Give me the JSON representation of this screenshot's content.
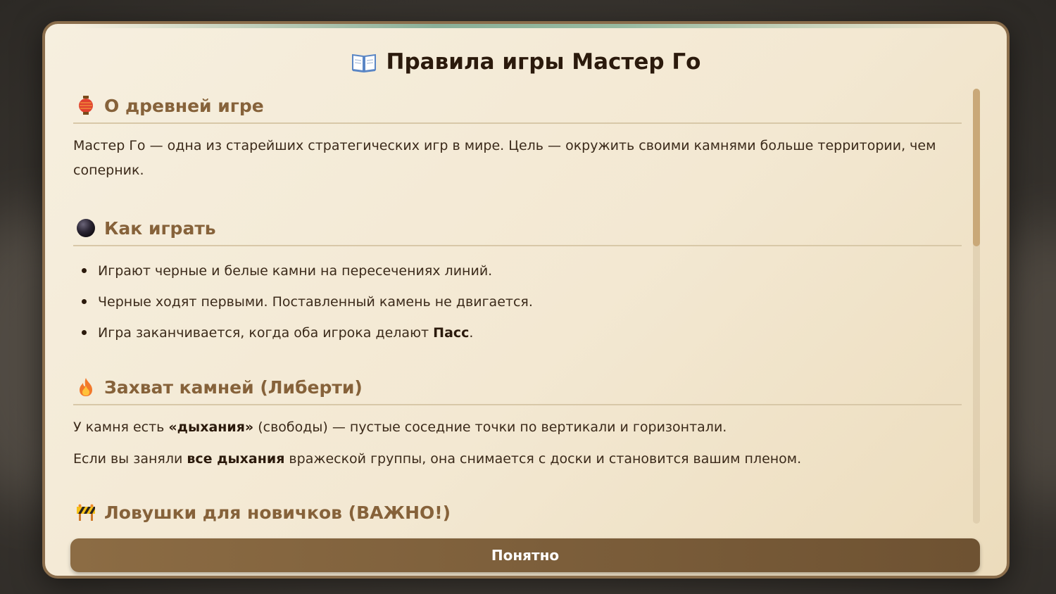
{
  "modal": {
    "title": "Правила игры Мастер Го",
    "title_icon": "open-book-icon"
  },
  "sections": [
    {
      "icon": "red-lantern-icon",
      "heading": "О древней игре",
      "paragraph": "Мастер Го — одна из старейших стратегических игр в мире. Цель — окружить своими камнями больше территории, чем соперник."
    },
    {
      "icon": "black-circle-icon",
      "heading": "Как играть",
      "items": [
        {
          "text": "Играют черные и белые камни на пересечениях линий."
        },
        {
          "text": "Черные ходят первыми. Поставленный камень не двигается."
        },
        {
          "text_before": "Игра заканчивается, когда оба игрока делают ",
          "bold": "Пасс",
          "text_after": "."
        }
      ]
    },
    {
      "icon": "fire-icon",
      "heading": "Захват камней (Либерти)",
      "p1": {
        "text_before": "У камня есть ",
        "bold": "«дыхания»",
        "text_after": " (свободы) — пустые соседние точки по вертикали и горизонтали."
      },
      "p2": {
        "text_before": "Если вы заняли ",
        "bold": "все дыхания",
        "text_after": " вражеской группы, она снимается с доски и становится вашим пленом."
      }
    },
    {
      "icon": "construction-barrier-icon",
      "heading": "Ловушки для новичков (ВАЖНО!)"
    }
  ],
  "button": {
    "label": "Понятно"
  },
  "colors": {
    "modal_bg": "#f3e8d2",
    "heading": "#86623a",
    "text": "#3b2a1a",
    "button": "#7d5f3b",
    "border": "#8a6d4b",
    "scrollbar_thumb": "#c9a878"
  }
}
